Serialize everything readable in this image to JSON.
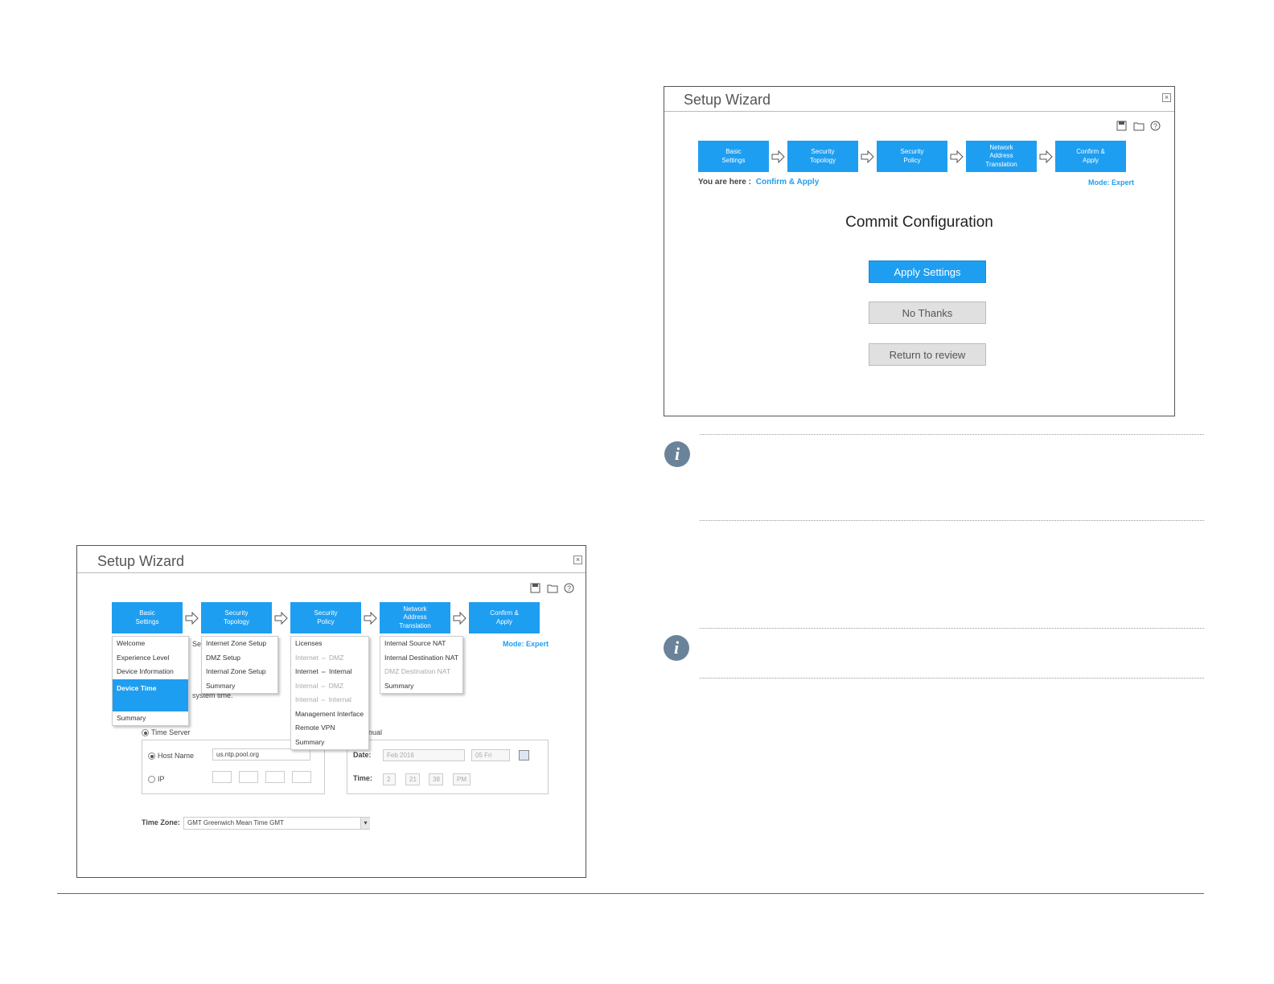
{
  "steps": [
    "Basic\nSettings",
    "Security\nTopology",
    "Security\nPolicy",
    "Network\nAddress\nTranslation",
    "Confirm &\nApply"
  ],
  "wizard_top": {
    "title": "Setup Wizard",
    "close": "×",
    "you_are_here_label": "You are here :",
    "you_are_here_value": "Confirm & Apply",
    "mode": "Mode: Expert",
    "heading": "Commit Configuration",
    "apply_button": "Apply Settings",
    "no_thanks_button": "No Thanks",
    "return_button": "Return to review"
  },
  "wizard_bottom": {
    "title": "Setup Wizard",
    "close": "×",
    "mode": "Mode: Expert",
    "menus": {
      "basic": [
        "Welcome",
        "Experience Level",
        "Device Information",
        "Device Time",
        "Summary"
      ],
      "topology": [
        "Internet Zone Setup",
        "DMZ Setup",
        "Internal Zone Setup",
        "Summary"
      ],
      "policy": [
        "Licenses",
        "Internet ⇔ DMZ",
        "Internet ⇔ Internal",
        "Internal ⇔ DMZ",
        "Internal ⇔ Internal",
        "Management Interface",
        "Remote VPN",
        "Summary"
      ],
      "nat": [
        "Internal Source NAT",
        "Internal Destination NAT",
        "DMZ Destination NAT",
        "Summary"
      ]
    },
    "partial_se": "Se",
    "partial_system_time": "system time.",
    "partial_manual": "nual",
    "time_server_label": "Time Server",
    "host_name_label": "Host Name",
    "host_name_value": "us.ntp.pool.org",
    "ip_label": "IP",
    "date_label": "Date:",
    "date_value": "Feb 2016",
    "date_day": "05 Fri",
    "time_label": "Time:",
    "time_hour": "2",
    "time_min": "21",
    "time_sec": "38",
    "time_ampm": "PM",
    "time_zone_label": "Time Zone:",
    "time_zone_value": "GMT Greenwich Mean Time GMT"
  },
  "info_icon_glyph": "i"
}
